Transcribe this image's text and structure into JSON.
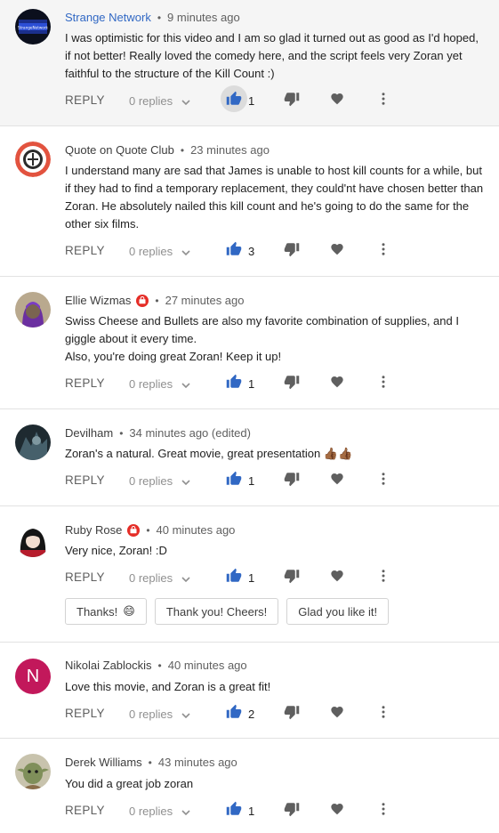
{
  "ui": {
    "reply_label": "REPLY",
    "replies_label": "0 replies",
    "separator": "•",
    "colors": {
      "like_blue": "#3168c4",
      "icon_gray": "#5f5f5f",
      "highlight_bg": "#f5f5f5",
      "badge_red": "#e52d27"
    }
  },
  "comments": [
    {
      "author": "Strange Network",
      "time": "9 minutes ago",
      "text": [
        "I was optimistic for this video and I am so glad it turned out as good as I'd hoped, if not better! Really loved the comedy here, and the script feels very Zoran yet faithful to the structure of the Kill Count :)"
      ],
      "likes": "1",
      "avatar_label": "StrangeNetwork",
      "highlighted": true
    },
    {
      "author": "Quote on Quote Club",
      "time": "23 minutes ago",
      "text": [
        "I understand many are sad that James is unable to host kill counts for a while, but if they had to find a temporary replacement, they could'nt have chosen better than Zoran. He absolutely nailed this kill count and he's going to do the same for the other six films."
      ],
      "likes": "3"
    },
    {
      "author": "Ellie Wizmas",
      "time": "27 minutes ago",
      "text": [
        "Swiss Cheese and Bullets are also my favorite combination of supplies, and I giggle about it every time.",
        "Also, you're doing great Zoran! Keep it up!"
      ],
      "likes": "1",
      "sponsor_badge": true
    },
    {
      "author": "Devilham",
      "time": "34 minutes ago (edited)",
      "text": [
        "Zoran's a natural. Great movie, great presentation 👍🏾👍🏾"
      ],
      "likes": "1"
    },
    {
      "author": "Ruby Rose",
      "time": "40 minutes ago",
      "text": [
        "Very nice, Zoran! :D"
      ],
      "likes": "1",
      "sponsor_badge": true,
      "quick_replies": [
        {
          "label": "Thanks!",
          "emoji": "😄"
        },
        {
          "label": "Thank you! Cheers!"
        },
        {
          "label": "Glad you like it!"
        }
      ]
    },
    {
      "author": "Nikolai Zablockis",
      "time": "40 minutes ago",
      "text": [
        "Love this movie, and Zoran is a great fit!"
      ],
      "likes": "2",
      "avatar_letter": "N"
    },
    {
      "author": "Derek Williams",
      "time": "43 minutes ago",
      "text": [
        "You did a great job zoran"
      ],
      "likes": "1"
    }
  ]
}
